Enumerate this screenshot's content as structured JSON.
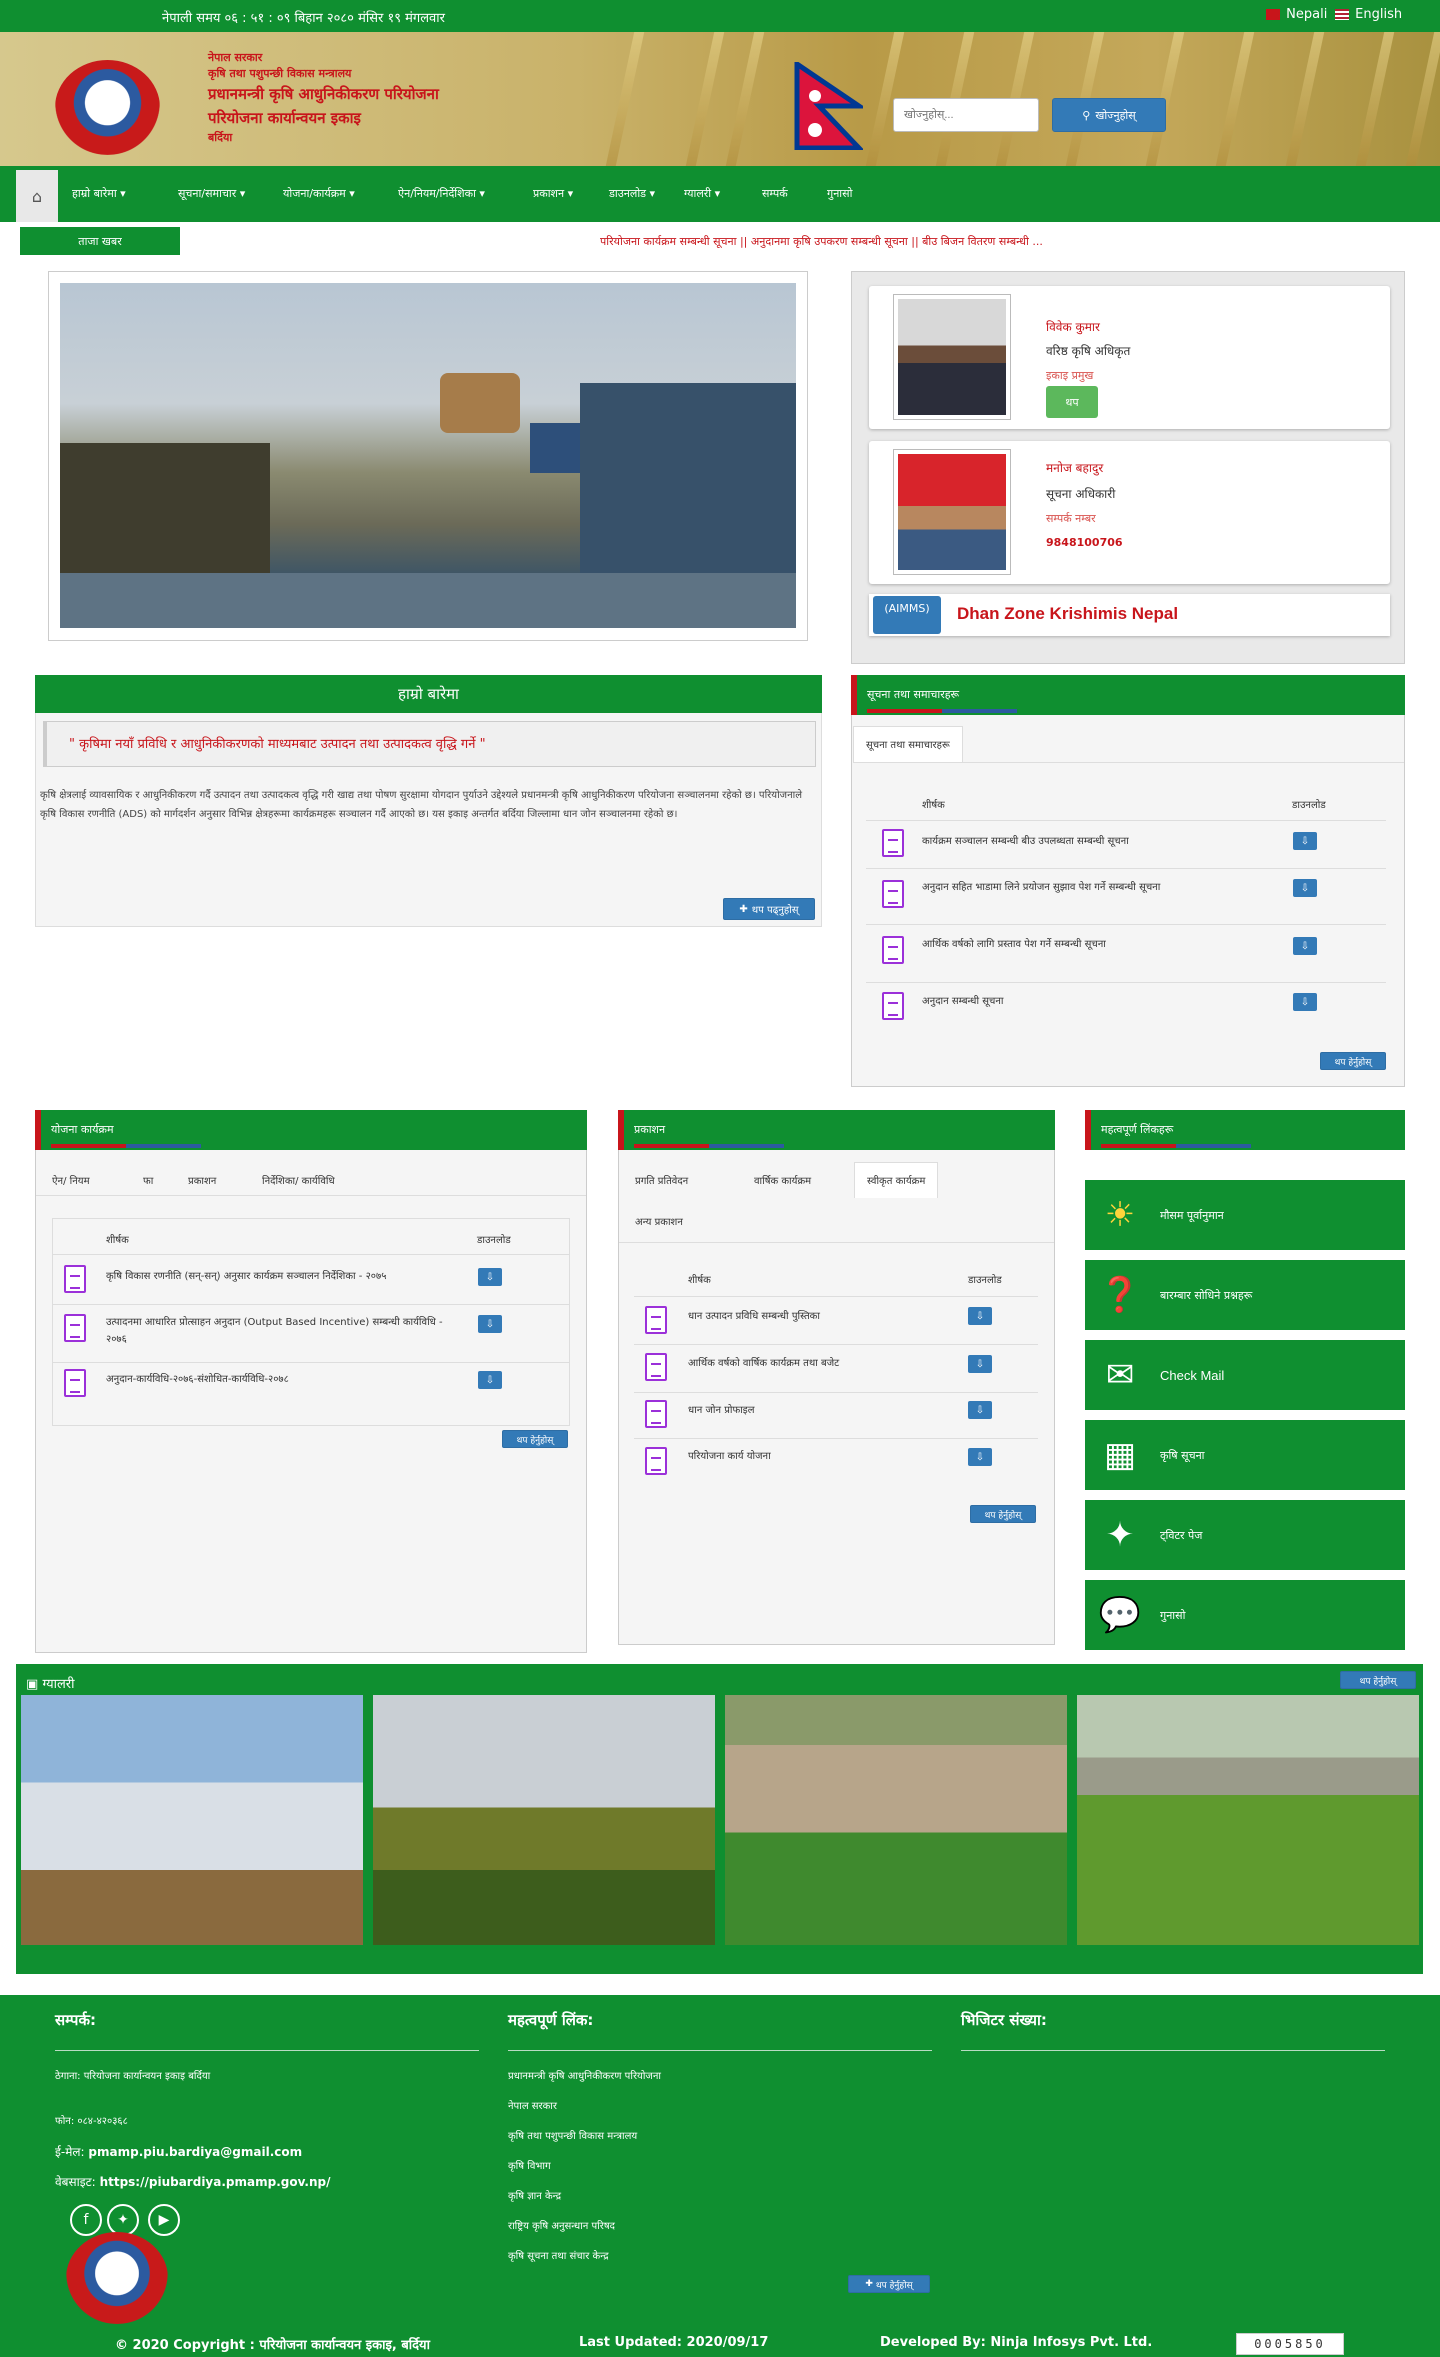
{
  "topbar": {
    "time": "नेपाली समय ०६ : ५१ : ०९ बिहान   २०८० मंसिर १९ मंगलवार",
    "lang_nepali": "Nepali",
    "lang_english": "English"
  },
  "header": {
    "line1": "नेपाल सरकार",
    "line2": "कृषि तथा पशुपन्छी विकास मन्त्रालय",
    "line3": "प्रधानमन्त्री कृषि आधुनिकीकरण परियोजना",
    "line4": "परियोजना कार्यान्वयन इकाइ",
    "line5": "बर्दिया",
    "search_placeholder": "खोज्नुहोस्...",
    "search_button": "खोज्नुहोस्"
  },
  "nav": {
    "items": [
      "हाम्रो बारेमा",
      "सूचना/समाचार",
      "योजना/कार्यक्रम",
      "ऐन/नियम/निर्देशिका",
      "प्रकाशन",
      "डाउनलोड",
      "ग्यालरी",
      "सम्पर्क",
      "गुनासो"
    ]
  },
  "ticker": {
    "label": "ताजा खबर",
    "text": "परियोजना कार्यक्रम सम्बन्धी सूचना ||    अनुदानमा कृषि उपकरण सम्बन्धी सूचना ||    बीउ बिजन वितरण सम्बन्धी ..."
  },
  "officials": [
    {
      "name": "विवेक कुमार",
      "role": "वरिष्ठ कृषि अधिकृत",
      "sub": "इकाइ प्रमुख",
      "button": "थप"
    },
    {
      "name": "मनोज बहादुर",
      "role": "सूचना अधिकारी",
      "sub": "सम्पर्क नम्बर",
      "phone": "9848100706"
    }
  ],
  "aimms": {
    "tag": "(AIMMS)",
    "text": "Dhan Zone Krishimis Nepal"
  },
  "intro": {
    "heading": "हाम्रो बारेमा",
    "quote": "\" कृषिमा नयाँ प्रविधि र आधुनिकीकरणको माध्यमबाट उत्पादन तथा उत्पादकत्व वृद्धि गर्ने \"",
    "text": "कृषि क्षेत्रलाई व्यावसायिक र आधुनिकीकरण गर्दै उत्पादन तथा उत्पादकत्व वृद्धि गरी खाद्य तथा पोषण सुरक्षामा योगदान पुर्याउने उद्देश्यले प्रधानमन्त्री कृषि आधुनिकीकरण परियोजना सञ्चालनमा रहेको छ। परियोजनाले कृषि विकास रणनीति (ADS) को मार्गदर्शन अनुसार विभिन्न क्षेत्रहरूमा कार्यक्रमहरू सञ्चालन गर्दै आएको छ। यस इकाइ अन्तर्गत बर्दिया जिल्लामा धान जोन सञ्चालनमा रहेको छ।",
    "more": "थप पढ्नुहोस्"
  },
  "notices": {
    "heading": "सूचना तथा समाचारहरू",
    "tab": "सूचना तथा समाचारहरू",
    "col_title": "शीर्षक",
    "col_dl": "डाउनलोड",
    "rows": [
      "कार्यक्रम सञ्चालन सम्बन्धी बीउ उपलब्धता सम्बन्धी सूचना",
      "अनुदान सहित भाडामा लिने प्रयोजन सुझाव पेश गर्ने सम्बन्धी सूचना",
      "आर्थिक वर्षको लागि प्रस्ताव पेश गर्ने सम्बन्धी सूचना",
      "अनुदान सम्बन्धी सूचना"
    ],
    "more": "थप हेर्नुहोस्"
  },
  "programs": {
    "heading": "योजना कार्यक्रम",
    "tabs": [
      "ऐन/ नियम",
      "फा",
      "प्रकाशन",
      "निर्देशिका/ कार्यविधि"
    ],
    "col_title": "शीर्षक",
    "col_dl": "डाउनलोड",
    "rows": [
      "कृषि विकास रणनीति (सन्-सन्) अनुसार कार्यक्रम सञ्चालन निर्देशिका - २०७५",
      "उत्पादनमा आधारित प्रोत्साहन अनुदान (Output Based Incentive) सम्बन्धी कार्यविधि - २०७६",
      "अनुदान-कार्यविधि-२०७६-संशोधित-कार्यविधि-२०७८"
    ],
    "more": "थप हेर्नुहोस्"
  },
  "downloads": {
    "heading": "प्रकाशन",
    "tabs": [
      "प्रगति प्रतिवेदन",
      "वार्षिक कार्यक्रम",
      "स्वीकृत कार्यक्रम",
      "अन्य प्रकाशन"
    ],
    "col_title": "शीर्षक",
    "col_dl": "डाउनलोड",
    "rows": [
      "धान उत्पादन प्रविधि सम्बन्धी पुस्तिका",
      "आर्थिक वर्षको वार्षिक कार्यक्रम तथा बजेट",
      "धान जोन प्रोफाइल",
      "परियोजना कार्य योजना"
    ],
    "more": "थप हेर्नुहोस्"
  },
  "services": {
    "heading": "महत्वपूर्ण लिंकहरू",
    "items": [
      "मौसम पूर्वानुमान",
      "बारम्बार सोधिने प्रश्नहरू",
      "Check Mail",
      "कृषि सूचना",
      "ट्विटर पेज",
      "गुनासो"
    ],
    "icons": [
      "weather-icon",
      "question-icon",
      "mail-icon",
      "calculator-icon",
      "twitter-icon",
      "chat-icon"
    ]
  },
  "gallery": {
    "heading": "ग्यालरी",
    "more": "थप हेर्नुहोस्"
  },
  "footer": {
    "contact_h": "सम्पर्क:",
    "address": "ठेगाना: परियोजना कार्यान्वयन इकाइ बर्दिया",
    "phone": "फोन: ०८४-४२०३६८",
    "email_label": "ई-मेल:",
    "email": "pmamp.piu.bardiya@gmail.com",
    "web_label": "वेबसाइट:",
    "web": "https://piubardiya.pmamp.gov.np/",
    "links_h": "महत्वपूर्ण लिंक:",
    "links": [
      "प्रधानमन्त्री कृषि आधुनिकीकरण परियोजना",
      "नेपाल सरकार",
      "कृषि तथा पशुपन्छी विकास मन्त्रालय",
      "कृषि विभाग",
      "कृषि ज्ञान केन्द्र",
      "राष्ट्रिय कृषि अनुसन्धान परिषद",
      "कृषि सूचना तथा संचार केन्द्र"
    ],
    "links_more": "थप हेर्नुहोस्",
    "visit_h": "भिजिटर संख्या:",
    "copyright": "© 2020 Copyright : परियोजना कार्यान्वयन इकाइ, बर्दिया",
    "updated": "Last Updated: 2020/09/17",
    "developer": "Developed By: Ninja Infosys Pvt. Ltd.",
    "counter": "0005850"
  },
  "colors": {
    "brand_green": "#0f8f30",
    "accent_red": "#c8151b",
    "button_blue": "#337ab7"
  }
}
